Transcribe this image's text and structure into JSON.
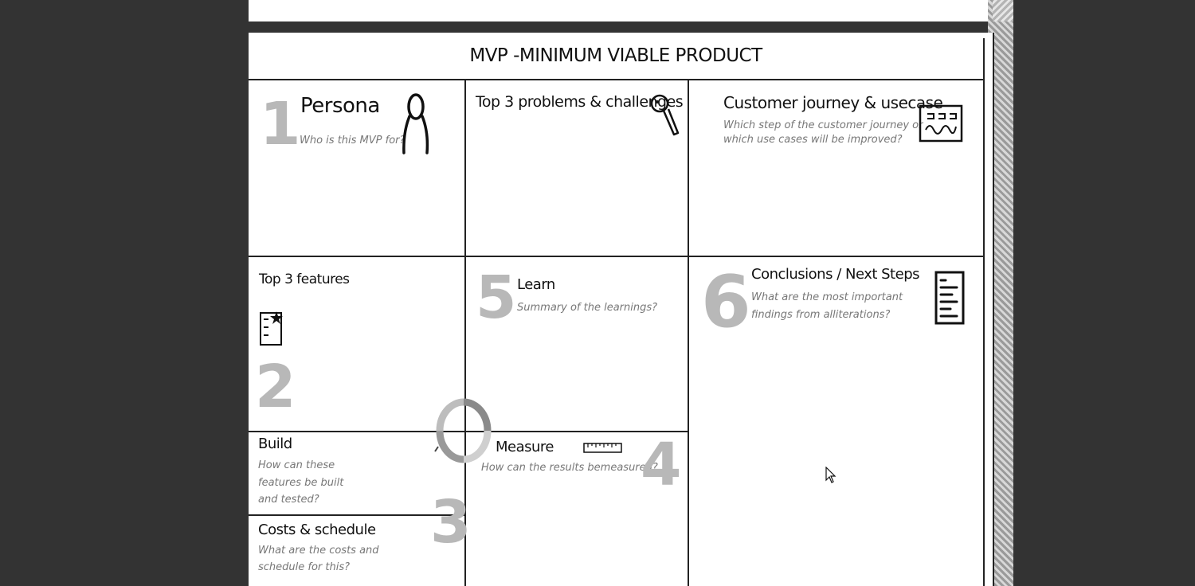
{
  "title": "MVP -MINIMUM VIABLE PRODUCT",
  "cells": {
    "persona": {
      "number": "1",
      "title": "Persona",
      "subtitle": "Who is this MVP for?"
    },
    "problems": {
      "title": "Top 3 problems & challenges"
    },
    "journey": {
      "title": "Customer journey & usecase",
      "subtitle_line1": "Which step of the customer journey or",
      "subtitle_line2": "which use cases will be improved?"
    },
    "features": {
      "number": "2",
      "title": "Top 3 features"
    },
    "learn": {
      "number": "5",
      "title": "Learn",
      "subtitle": "Summary of the learnings?"
    },
    "conclusions": {
      "number": "6",
      "title": "Conclusions / Next Steps",
      "subtitle_line1": "What are the most important",
      "subtitle_line2": "findings from alliterations?"
    },
    "build": {
      "title": "Build",
      "subtitle_line1": "How can these",
      "subtitle_line2": "features be built",
      "subtitle_line3": "and tested?"
    },
    "measure": {
      "number": "4",
      "title": "Measure",
      "subtitle": "How can the results bemeasured?"
    },
    "costs": {
      "number": "3",
      "title": "Costs & schedule",
      "subtitle_line1": "What are the costs and",
      "subtitle_line2": "schedule for this?"
    }
  },
  "icons": [
    "person-icon",
    "magnifier-icon",
    "journey-card-icon",
    "feature-list-icon",
    "document-list-icon",
    "ruler-icon",
    "cycle-ring-icon",
    "mouse-cursor-icon"
  ]
}
